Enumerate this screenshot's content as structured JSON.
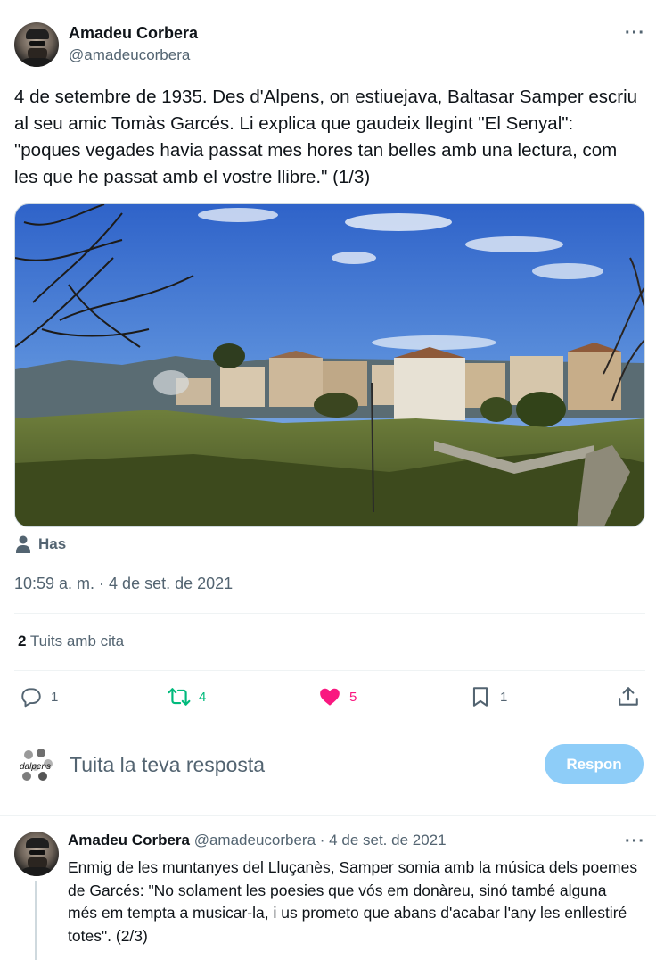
{
  "main_tweet": {
    "author_name": "Amadeu Corbera",
    "author_handle": "@amadeucorbera",
    "more_label": "···",
    "text": "4 de setembre de 1935. Des d'Alpens, on  estiuejava, Baltasar Samper escriu al seu amic Tomàs Garcés. Li explica que gaudeix llegint \"El Senyal\": \"poques vegades havia passat mes hores tan belles amb una lectura, com les que he passat amb el vostre llibre.\" (1/3)",
    "tagged_user": "Has",
    "timestamp": "10:59 a. m. · 4 de set. de 2021",
    "quotes_count": "2",
    "quotes_label": "Tuits amb cita"
  },
  "actions": {
    "reply_count": "1",
    "retweet_count": "4",
    "like_count": "5",
    "bookmark_count": "1",
    "retweet_color": "#00ba7c",
    "like_color": "#f91880",
    "icon_names": [
      "reply-icon",
      "retweet-icon",
      "like-icon",
      "bookmark-icon",
      "share-icon"
    ]
  },
  "reply_box": {
    "avatar_text": "dalpens",
    "placeholder": "Tuita la teva resposta",
    "button_label": "Respon"
  },
  "second_tweet": {
    "author_name": "Amadeu Corbera",
    "author_handle": "@amadeucorbera",
    "date": "· 4 de set. de 2021",
    "more_label": "···",
    "text": "Enmig de les muntanyes del Lluçanès, Samper somia amb la música dels poemes de Garcés: \"No solament les poesies que vós em donàreu, sinó també alguna més em tempta a musicar-la, i us prometo  que abans d'acabar l'any les enllestiré totes\". (2/3)"
  },
  "colors": {
    "text_primary": "#0f1419",
    "text_secondary": "#536471",
    "accent": "#1d9bf0",
    "button_disabled": "#8ecdf8"
  }
}
